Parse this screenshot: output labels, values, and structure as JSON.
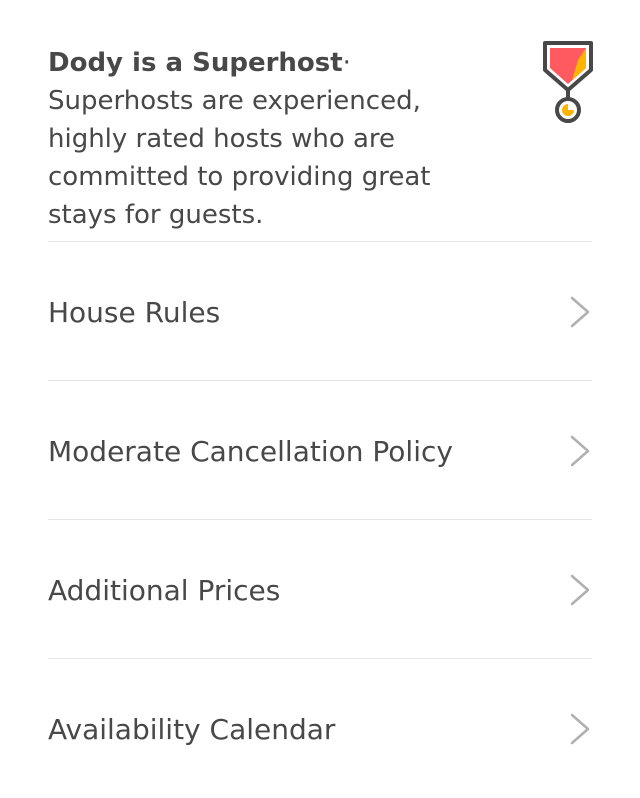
{
  "superhost": {
    "title": "Dody is a Superhost",
    "description": "· Superhosts are experienced, highly rated hosts who are committed to providing great stays for guests.",
    "badge_icon": "superhost-badge-icon",
    "badge_colors": {
      "outline": "#484848",
      "red": "#FF5A5F",
      "yellow": "#FFB400"
    }
  },
  "rows": [
    {
      "label": "House Rules",
      "icon": "chevron-right-icon"
    },
    {
      "label": "Moderate Cancellation Policy",
      "icon": "chevron-right-icon"
    },
    {
      "label": "Additional Prices",
      "icon": "chevron-right-icon"
    },
    {
      "label": "Availability Calendar",
      "icon": "chevron-right-icon"
    }
  ],
  "colors": {
    "text": "#484848",
    "divider": "#e4e4e4",
    "chevron": "#b0b0b0"
  }
}
